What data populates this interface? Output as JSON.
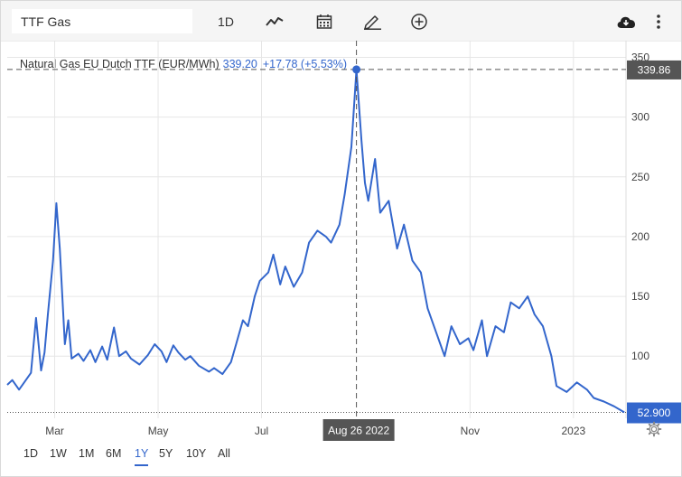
{
  "toolbar": {
    "search_value": "TTF Gas",
    "interval_label": "1D",
    "icons": [
      "chart-type-icon",
      "calendar-icon",
      "pencil-icon",
      "plus-circle-icon",
      "download-cloud-icon",
      "more-vert-icon"
    ]
  },
  "legend": {
    "name": "Natural Gas EU Dutch TTF (EUR/MWh)",
    "value": "339.20",
    "change": "+17.78 (+5.53%)"
  },
  "ranges": [
    "1D",
    "1W",
    "1M",
    "6M",
    "1Y",
    "5Y",
    "10Y",
    "All"
  ],
  "active_range": "1Y",
  "colors": {
    "line": "#3366cc",
    "crosshair": "#555555",
    "badge_dark": "#555555",
    "badge_blue": "#3366cc"
  },
  "chart_data": {
    "type": "line",
    "title": "",
    "xlabel": "",
    "ylabel": "",
    "y_ticks": [
      100,
      150,
      200,
      250,
      300,
      350
    ],
    "ylim": [
      48,
      364
    ],
    "x_tick_labels": [
      "Mar",
      "May",
      "Jul",
      "Nov",
      "2023"
    ],
    "crosshair": {
      "date_label": "Aug 26 2022",
      "value_label": "339.86",
      "value": 339.86
    },
    "last_value_label": "52.900",
    "last_value": 52.9,
    "grid": true,
    "series": [
      {
        "name": "",
        "x": [
          "2022-02-01",
          "2022-02-04",
          "2022-02-08",
          "2022-02-11",
          "2022-02-15",
          "2022-02-18",
          "2022-02-21",
          "2022-02-23",
          "2022-02-25",
          "2022-02-28",
          "2022-03-02",
          "2022-03-04",
          "2022-03-07",
          "2022-03-09",
          "2022-03-11",
          "2022-03-15",
          "2022-03-18",
          "2022-03-22",
          "2022-03-25",
          "2022-03-29",
          "2022-04-01",
          "2022-04-05",
          "2022-04-08",
          "2022-04-12",
          "2022-04-15",
          "2022-04-20",
          "2022-04-25",
          "2022-04-29",
          "2022-05-03",
          "2022-05-06",
          "2022-05-10",
          "2022-05-13",
          "2022-05-17",
          "2022-05-20",
          "2022-05-25",
          "2022-05-31",
          "2022-06-03",
          "2022-06-08",
          "2022-06-13",
          "2022-06-16",
          "2022-06-20",
          "2022-06-23",
          "2022-06-27",
          "2022-06-30",
          "2022-07-05",
          "2022-07-08",
          "2022-07-12",
          "2022-07-15",
          "2022-07-20",
          "2022-07-25",
          "2022-07-29",
          "2022-08-03",
          "2022-08-08",
          "2022-08-11",
          "2022-08-16",
          "2022-08-19",
          "2022-08-23",
          "2022-08-26",
          "2022-08-29",
          "2022-08-31",
          "2022-09-02",
          "2022-09-06",
          "2022-09-09",
          "2022-09-14",
          "2022-09-19",
          "2022-09-23",
          "2022-09-28",
          "2022-10-03",
          "2022-10-07",
          "2022-10-12",
          "2022-10-17",
          "2022-10-21",
          "2022-10-26",
          "2022-10-31",
          "2022-11-03",
          "2022-11-08",
          "2022-11-11",
          "2022-11-16",
          "2022-11-21",
          "2022-11-25",
          "2022-11-30",
          "2022-12-05",
          "2022-12-09",
          "2022-12-14",
          "2022-12-19",
          "2022-12-22",
          "2022-12-28",
          "2023-01-03",
          "2023-01-09",
          "2023-01-13",
          "2023-01-19",
          "2023-01-25",
          "2023-01-31"
        ],
        "y": [
          76,
          80,
          72,
          78,
          86,
          132,
          88,
          103,
          135,
          180,
          228,
          190,
          110,
          130,
          98,
          102,
          96,
          105,
          95,
          108,
          97,
          124,
          100,
          104,
          98,
          93,
          101,
          110,
          104,
          95,
          109,
          103,
          97,
          100,
          92,
          87,
          90,
          85,
          95,
          110,
          130,
          125,
          150,
          163,
          170,
          185,
          160,
          175,
          158,
          170,
          195,
          205,
          200,
          195,
          210,
          235,
          275,
          339.86,
          280,
          245,
          230,
          265,
          220,
          230,
          190,
          210,
          180,
          170,
          140,
          120,
          100,
          125,
          110,
          115,
          105,
          130,
          100,
          125,
          120,
          145,
          140,
          150,
          135,
          125,
          100,
          75,
          70,
          78,
          72,
          65,
          62,
          58,
          53
        ]
      }
    ]
  }
}
